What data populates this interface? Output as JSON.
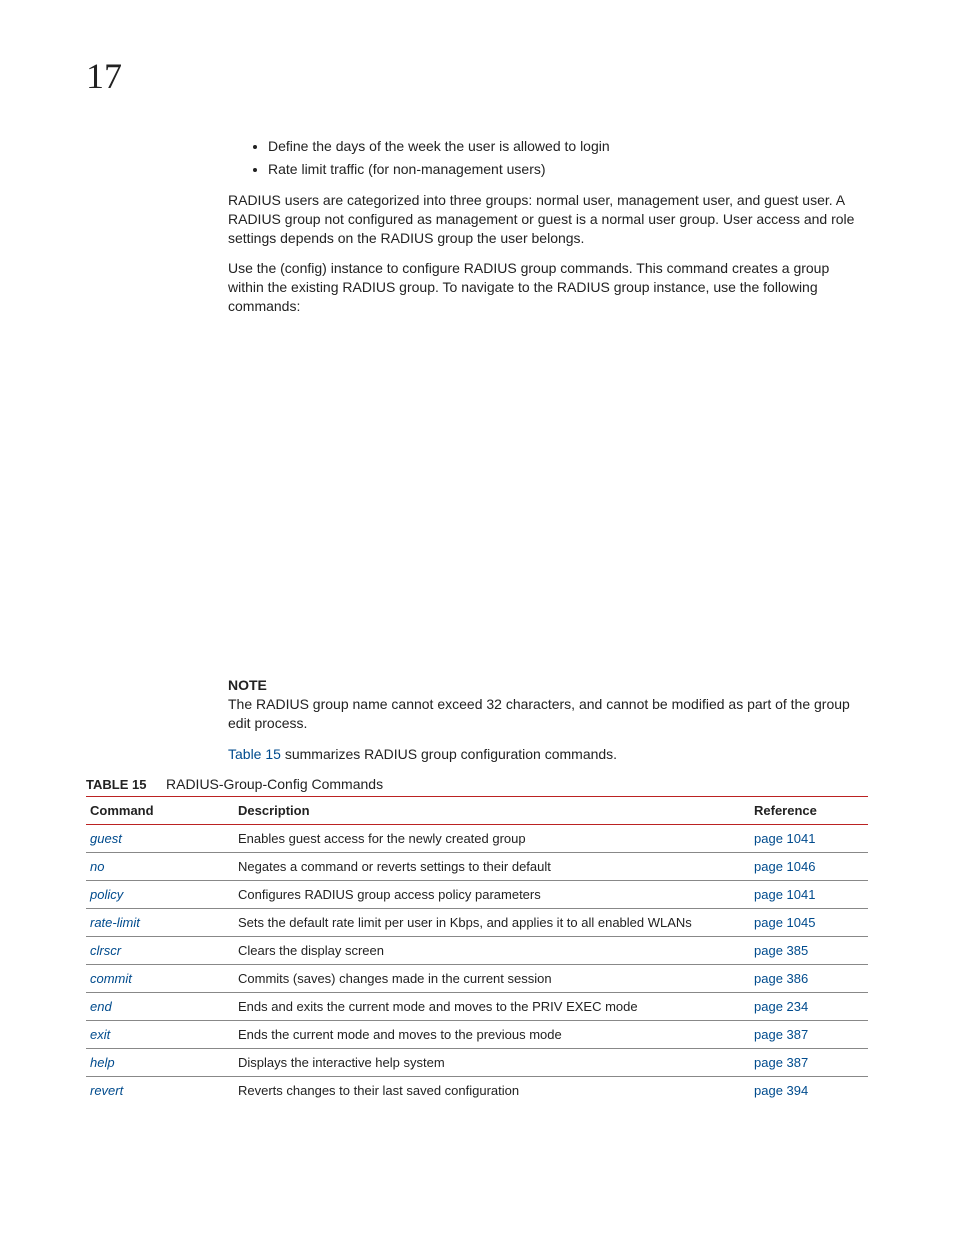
{
  "chapter": "17",
  "bullets": [
    "Define the days of the week the user is allowed to login",
    "Rate limit traffic (for non-management users)"
  ],
  "para1": "RADIUS users are categorized into three groups: normal user, management user, and guest user. A RADIUS group not configured as management or guest is a normal user group. User access and role settings depends on the RADIUS group the user belongs.",
  "para2": "Use the (config) instance to configure RADIUS group commands. This command creates a group within the existing RADIUS group. To navigate to the RADIUS group instance, use the following commands:",
  "note_label": "NOTE",
  "note_text": "The RADIUS group name cannot exceed 32 characters, and cannot be modified as part of the group edit process.",
  "summary_prefix": "Table 15",
  "summary_rest": " summarizes RADIUS group configuration commands.",
  "table_number": "TABLE 15",
  "table_title": "RADIUS-Group-Config Commands",
  "headers": {
    "cmd": "Command",
    "desc": "Description",
    "ref": "Reference"
  },
  "rows": [
    {
      "cmd": "guest",
      "desc": "Enables guest access for the newly created group",
      "ref": "page 1041"
    },
    {
      "cmd": "no",
      "desc": "Negates a command or reverts settings to their default",
      "ref": "page 1046"
    },
    {
      "cmd": "policy",
      "desc": "Configures RADIUS group access policy parameters",
      "ref": "page 1041"
    },
    {
      "cmd": "rate-limit",
      "desc": "Sets the default rate limit per user in Kbps, and applies it to all enabled WLANs",
      "ref": "page 1045"
    },
    {
      "cmd": "clrscr",
      "desc": "Clears the display screen",
      "ref": "page 385"
    },
    {
      "cmd": "commit",
      "desc": "Commits (saves) changes made in the current session",
      "ref": "page 386"
    },
    {
      "cmd": "end",
      "desc": "Ends and exits the current mode and moves to the PRIV EXEC mode",
      "ref": "page 234"
    },
    {
      "cmd": "exit",
      "desc": "Ends the current mode and moves to the previous mode",
      "ref": "page 387"
    },
    {
      "cmd": "help",
      "desc": "Displays the interactive help system",
      "ref": "page 387"
    },
    {
      "cmd": "revert",
      "desc": "Reverts changes to their last saved configuration",
      "ref": "page 394"
    }
  ]
}
